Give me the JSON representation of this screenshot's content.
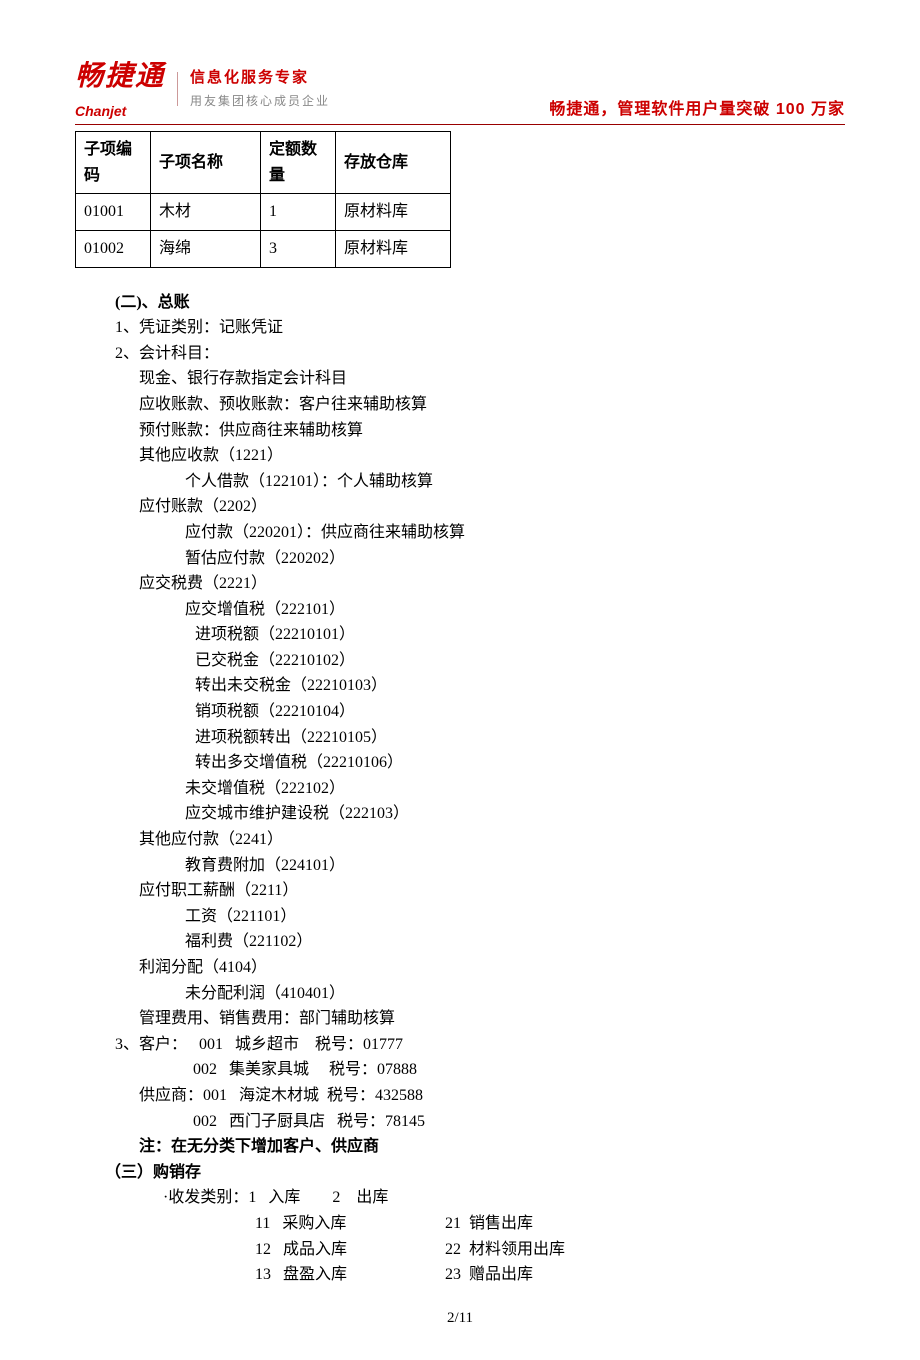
{
  "header": {
    "logo_cn": "畅捷通",
    "logo_en": "Chanjet",
    "tagline1": "信息化服务专家",
    "tagline2": "用友集团核心成员企业",
    "right": "畅捷通，管理软件用户量突破 100 万家"
  },
  "table": {
    "h1": "子项编码",
    "h2": "子项名称",
    "h3": "定额数量",
    "h4": "存放仓库",
    "r1c1": "01001",
    "r1c2": "木材",
    "r1c3": "1",
    "r1c4": "原材料库",
    "r2c1": "01002",
    "r2c2": "海绵",
    "r2c3": "3",
    "r2c4": "原材料库"
  },
  "sec2_title": "(二)、总账",
  "i1": "1、凭证类别：记账凭证",
  "i2": "2、会计科目：",
  "a1": "现金、银行存款指定会计科目",
  "a2": "应收账款、预收账款：客户往来辅助核算",
  "a3": "预付账款：供应商往来辅助核算",
  "a4": "其他应收款（1221）",
  "a4_1": "个人借款（122101）：个人辅助核算",
  "a5": "应付账款（2202）",
  "a5_1": "应付款（220201）：供应商往来辅助核算",
  "a5_2": "暂估应付款（220202）",
  "a6": "应交税费（2221）",
  "a6_1": "应交增值税（222101）",
  "a6_1_1": "进项税额（22210101）",
  "a6_1_2": "已交税金（22210102）",
  "a6_1_3": "转出未交税金（22210103）",
  "a6_1_4": "销项税额（22210104）",
  "a6_1_5": "进项税额转出（22210105）",
  "a6_1_6": "转出多交增值税（22210106）",
  "a6_2": "未交增值税（222102）",
  "a6_3": "应交城市维护建设税（222103）",
  "a7": "其他应付款（2241）",
  "a7_1": "教育费附加（224101）",
  "a8": "应付职工薪酬（2211）",
  "a8_1": "工资（221101）",
  "a8_2": "福利费（221102）",
  "a9": "利润分配（4104）",
  "a9_1": "未分配利润（410401）",
  "a10": "管理费用、销售费用：部门辅助核算",
  "i3": "3、客户：   001   城乡超市    税号：01777",
  "c2": "002   集美家具城     税号：07888",
  "sup1": "供应商：001   海淀木材城  税号：432588",
  "sup2": "002   西门子厨具店   税号：78145",
  "note": "注：在无分类下增加客户、供应商",
  "sec3_title": "（三）购销存",
  "io_head": "·收发类别：1   入库        2    出库",
  "io_r1a": "11   采购入库",
  "io_r1b": "21  销售出库",
  "io_r2a": "12   成品入库",
  "io_r2b": "22  材料领用出库",
  "io_r3a": "13   盘盈入库",
  "io_r3b": "23  赠品出库",
  "footer": "2/11"
}
